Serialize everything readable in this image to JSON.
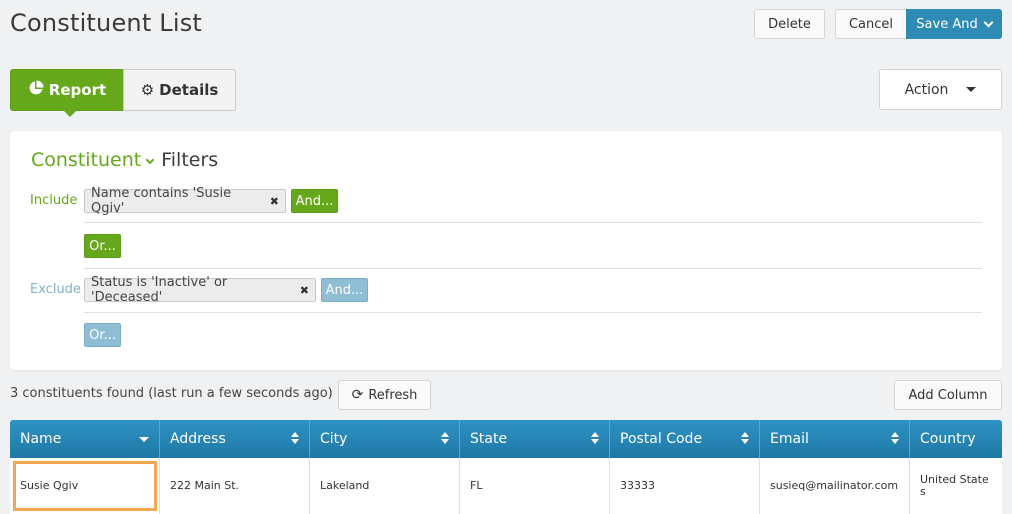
{
  "page": {
    "title": "Constituent List"
  },
  "toolbar": {
    "delete_label": "Delete",
    "cancel_label": "Cancel",
    "save_label": "Save And",
    "action_label": "Action"
  },
  "tabs": [
    {
      "label": "Report",
      "icon": "pie-chart-icon",
      "active": true
    },
    {
      "label": "Details",
      "icon": "gear-icon",
      "active": false
    }
  ],
  "filters": {
    "entity": "Constituent",
    "heading": "Filters",
    "include": {
      "label": "Include",
      "condition": "Name contains 'Susie Qgiv'",
      "and_label": "And...",
      "or_label": "Or..."
    },
    "exclude": {
      "label": "Exclude",
      "condition": "Status is 'Inactive' or 'Deceased'",
      "and_label": "And...",
      "or_label": "Or..."
    }
  },
  "results": {
    "summary": "3 constituents found (last run a few seconds ago)",
    "refresh_label": "Refresh",
    "add_column_label": "Add Column"
  },
  "table": {
    "columns": [
      "Name",
      "Address",
      "City",
      "State",
      "Postal Code",
      "Email",
      "Country"
    ],
    "rows": [
      [
        "Susie Qgiv",
        "222 Main St.",
        "Lakeland",
        "FL",
        "33333",
        "susieq@mailinator.com",
        "United States"
      ]
    ]
  },
  "colors": {
    "brand_green": "#66a81c",
    "header_blue": "#2e8bb5",
    "exclude_blue": "#8fbdd3",
    "highlight": "#f4a650"
  }
}
